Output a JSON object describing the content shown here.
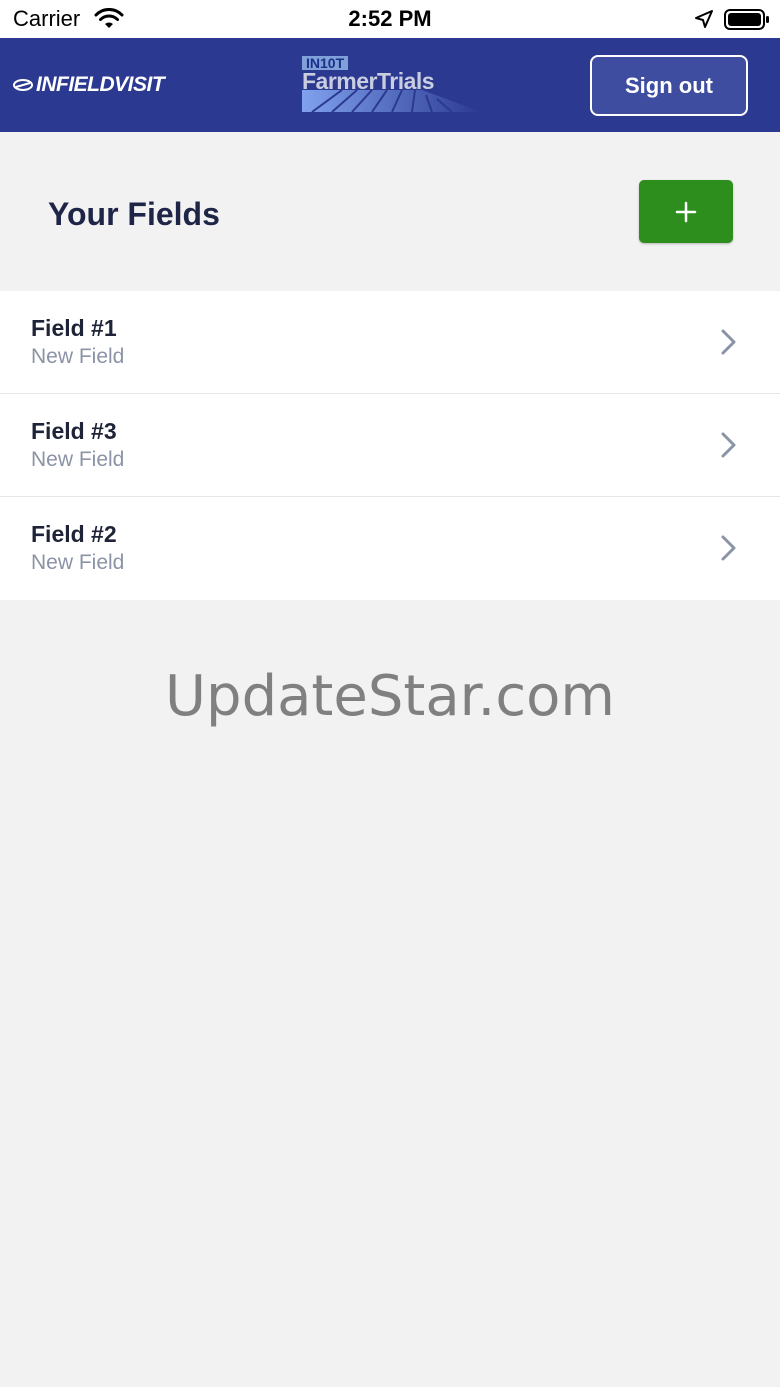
{
  "status_bar": {
    "carrier": "Carrier",
    "time": "2:52 PM"
  },
  "header": {
    "brand_left": "INFIELDVISIT",
    "brand_center_small": "IN10T",
    "brand_center_big": "FarmerTrials",
    "sign_out_label": "Sign out",
    "background_color": "#2b3990"
  },
  "page": {
    "title": "Your Fields",
    "add_button_label": "+",
    "add_button_color": "#2d8e1e"
  },
  "fields": [
    {
      "name": "Field #1",
      "subtitle": "New Field"
    },
    {
      "name": "Field #3",
      "subtitle": "New Field"
    },
    {
      "name": "Field #2",
      "subtitle": "New Field"
    }
  ],
  "watermark": "UpdateStar.com"
}
